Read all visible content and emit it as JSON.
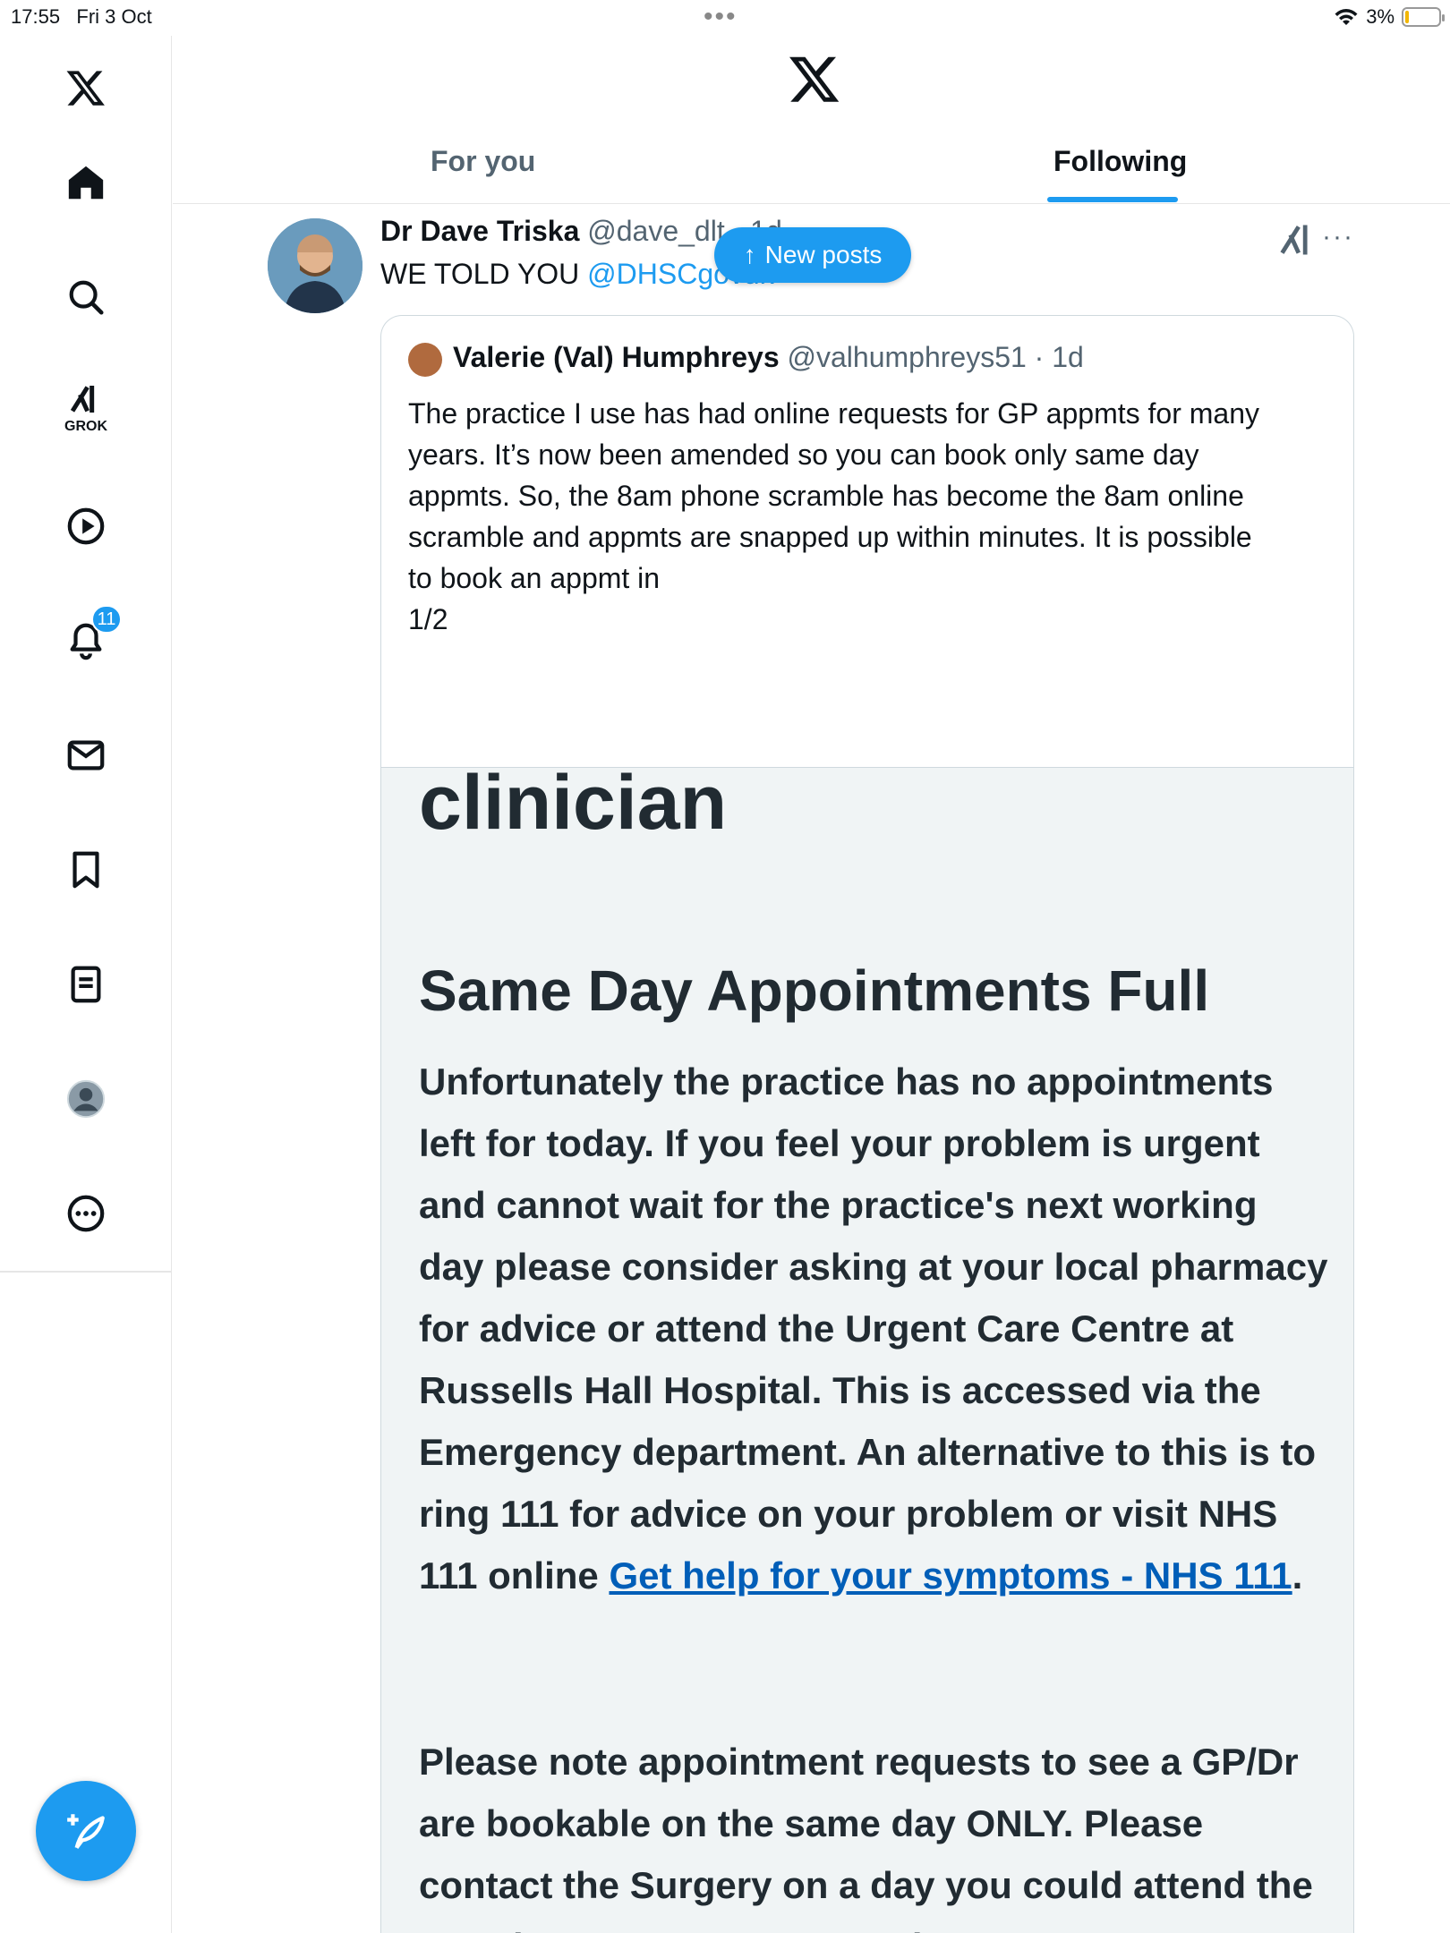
{
  "status_bar": {
    "time": "17:55",
    "date": "Fri 3 Oct",
    "battery": "3%"
  },
  "sidebar": {
    "items": [
      {
        "icon": "x-logo-icon"
      },
      {
        "icon": "home-icon"
      },
      {
        "icon": "search-icon"
      },
      {
        "icon": "grok-icon",
        "label": "GROK"
      },
      {
        "icon": "video-play-icon"
      },
      {
        "icon": "notifications-bell-icon",
        "badge": "11"
      },
      {
        "icon": "messages-envelope-icon"
      },
      {
        "icon": "bookmark-icon"
      },
      {
        "icon": "lists-icon"
      },
      {
        "icon": "profile-avatar-icon"
      },
      {
        "icon": "more-icon"
      }
    ]
  },
  "header": {
    "tabs": [
      "For you",
      "Following"
    ],
    "active_tab": "Following"
  },
  "new_posts": {
    "label": "New posts"
  },
  "post": {
    "author_name": "Dr Dave Triska",
    "author_handle": "@dave_dlt · 1d",
    "text": "WE TOLD YOU ",
    "mention": "@DHSCgovuk",
    "quote": {
      "author_name": "Valerie (Val) Humphreys",
      "author_handle": "@valhumphreys51 · 1d",
      "text_lines": [
        "The practice I use has had online requests for GP appmts for many",
        "years. It’s now been amended so you can book only same day",
        "appmts. So, the 8am phone scramble has become the 8am online",
        "scramble and appmts are snapped up within minutes. It is possible",
        "to book an appmt in",
        "1/2"
      ],
      "image": {
        "heading_top": "clinician",
        "heading": "Same Day Appointments Full",
        "para1": "Unfortunately the practice has no appointments left for today. If you feel your problem is urgent and cannot wait for the practice's next working day please consider asking at your local pharmacy for advice or attend the Urgent Care Centre at Russells Hall Hospital. This is accessed via the Emergency department. An alternative to this is to ring 111 for advice on your problem or visit NHS 111 online ",
        "link": "Get help for your symptoms - NHS 111",
        "para1_end": ".",
        "para2": "Please note appointment requests to see a GP/Dr are bookable on the same day ONLY. Please contact the Surgery on a day you could attend the Practice to request an appointment."
      }
    }
  },
  "colors": {
    "accent": "#1d9bf0",
    "text": "#0f1419",
    "muted": "#536471",
    "nhs_link": "#005eb8"
  }
}
